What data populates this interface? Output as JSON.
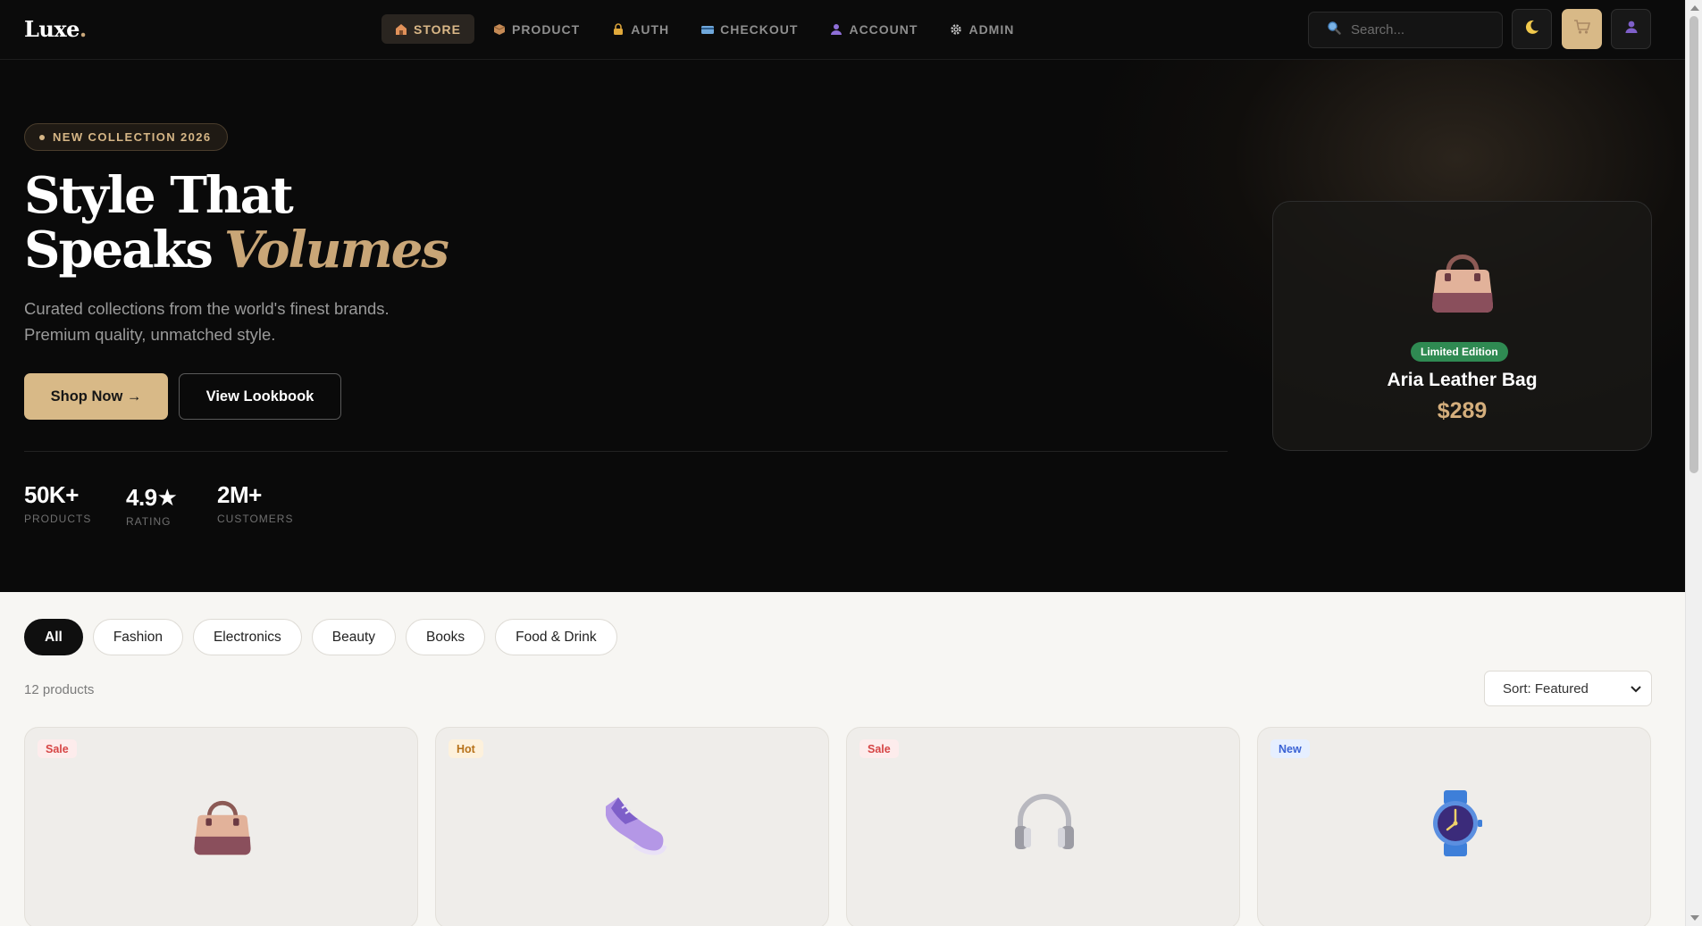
{
  "brand": {
    "logo_text": "Luxe",
    "logo_dot": "."
  },
  "nav": {
    "items": [
      {
        "label": "STORE",
        "icon": "store-icon",
        "active": true
      },
      {
        "label": "PRODUCT",
        "icon": "box-icon",
        "active": false
      },
      {
        "label": "AUTH",
        "icon": "lock-icon",
        "active": false
      },
      {
        "label": "CHECKOUT",
        "icon": "credit-card-icon",
        "active": false
      },
      {
        "label": "ACCOUNT",
        "icon": "user-icon",
        "active": false
      },
      {
        "label": "ADMIN",
        "icon": "gear-icon",
        "active": false
      }
    ],
    "search_placeholder": "Search..."
  },
  "hero": {
    "badge": "NEW COLLECTION 2026",
    "title_line1": "Style That",
    "title_line2": "Speaks",
    "title_accent": "Volumes",
    "subtitle_line1": "Curated collections from the world's finest brands.",
    "subtitle_line2": "Premium quality, unmatched style.",
    "primary_cta": "Shop Now →",
    "secondary_cta": "View Lookbook",
    "stats": [
      {
        "value": "50K+",
        "label": "PRODUCTS"
      },
      {
        "value": "4.9★",
        "label": "RATING"
      },
      {
        "value": "2M+",
        "label": "CUSTOMERS"
      }
    ],
    "featured": {
      "badge": "Limited Edition",
      "name": "Aria Leather Bag",
      "price": "$289",
      "icon": "handbag-icon"
    }
  },
  "catalog": {
    "filters": [
      "All",
      "Fashion",
      "Electronics",
      "Beauty",
      "Books",
      "Food & Drink"
    ],
    "active_filter": "All",
    "count_text": "12 products",
    "sort_label": "Sort: Featured",
    "products": [
      {
        "tag": "Sale",
        "icon": "handbag-icon"
      },
      {
        "tag": "Hot",
        "icon": "sneaker-icon"
      },
      {
        "tag": "Sale",
        "icon": "headphones-icon"
      },
      {
        "tag": "New",
        "icon": "watch-icon"
      }
    ]
  },
  "colors": {
    "accent_gold": "#d8b987",
    "nav_bg": "#0b0b0b",
    "limited_green": "#2f8a52",
    "sale_red": "#d64545",
    "hot_orange": "#b7721a",
    "new_blue": "#3a62d4"
  }
}
